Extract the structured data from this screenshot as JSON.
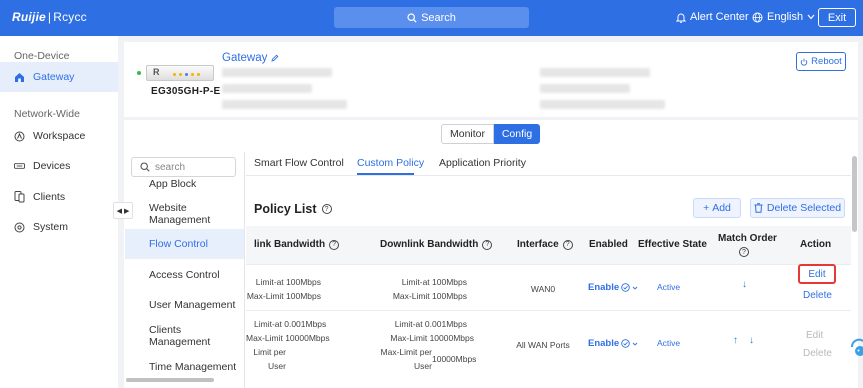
{
  "topbar": {
    "logo_brand": "Ruijie",
    "logo_sep": "|",
    "logo_product": "Rcycc",
    "search_label": "Search",
    "alert_label": "Alert Center",
    "language_label": "English",
    "exit_label": "Exit"
  },
  "sidebar": {
    "section_one": "One-Device",
    "section_two": "Network-Wide",
    "items": [
      {
        "label": "Gateway",
        "icon": "home-icon"
      },
      {
        "label": "Workspace",
        "icon": "workspace-icon"
      },
      {
        "label": "Devices",
        "icon": "devices-icon"
      },
      {
        "label": "Clients",
        "icon": "clients-icon"
      },
      {
        "label": "System",
        "icon": "system-icon"
      }
    ]
  },
  "device": {
    "model": "EG305GH-P-E",
    "name": "Gateway",
    "reboot_label": "Reboot"
  },
  "mode_switch": {
    "monitor": "Monitor",
    "config": "Config"
  },
  "submenu": {
    "search_placeholder": "search",
    "items": [
      "App Block",
      "Website Management",
      "Flow Control",
      "Access Control",
      "User Management",
      "Clients Management",
      "Time Management"
    ]
  },
  "tabs": [
    "Smart Flow Control",
    "Custom Policy",
    "Application Priority"
  ],
  "policy": {
    "title": "Policy List",
    "add_label": "Add",
    "delete_label": "Delete Selected",
    "columns": {
      "uplink": "link Bandwidth",
      "downlink": "Downlink Bandwidth",
      "interface": "Interface",
      "enabled": "Enabled",
      "effective": "Effective State",
      "match_order": "Match Order",
      "action": "Action"
    },
    "rows": [
      {
        "up_min": "Limit-at 100Mbps",
        "up_max": "Max-Limit 100Mbps",
        "down_min": "Limit-at 100Mbps",
        "down_max": "Max-Limit 100Mbps",
        "interface": "WAN0",
        "enabled": "Enable",
        "effective": "Active",
        "edit": "Edit",
        "delete": "Delete"
      },
      {
        "up_min": "Limit-at 0.001Mbps",
        "up_max": "Max-Limit 10000Mbps",
        "up_user_1": "Limit per",
        "up_user_2": "User",
        "down_min": "Limit-at 0.001Mbps",
        "down_max": "Max-Limit 10000Mbps",
        "down_user_1": "Max-Limit per",
        "down_user_2": "User",
        "down_user_val": "10000Mbps",
        "interface": "All WAN Ports",
        "enabled": "Enable",
        "effective": "Active",
        "edit": "Edit",
        "delete": "Delete"
      }
    ]
  },
  "colors": {
    "accent": "#2f6fe4",
    "highlight": "#e53935",
    "status_online": "#3db84a"
  }
}
